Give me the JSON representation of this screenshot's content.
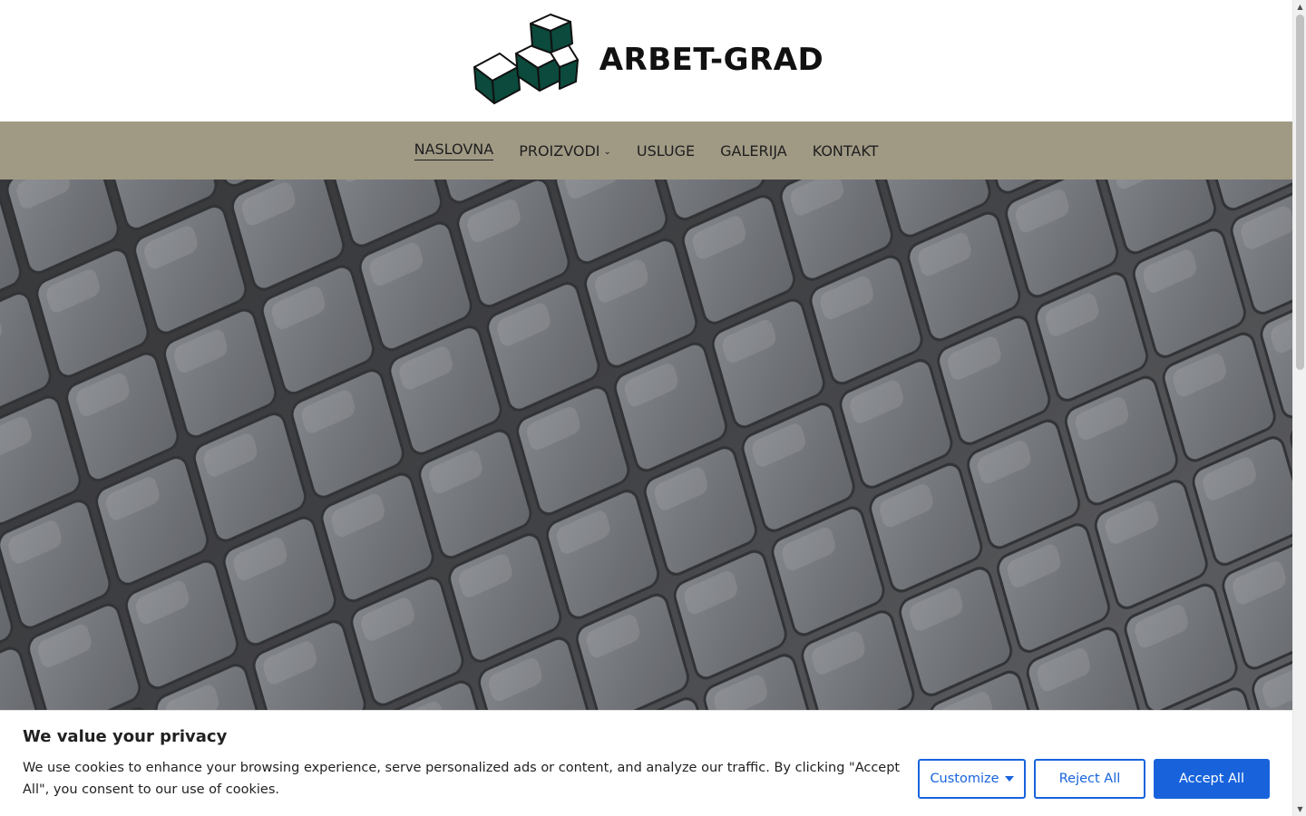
{
  "brand": {
    "name": "ARBET-GRAD",
    "logo_color": "#0b4a3c"
  },
  "nav": {
    "items": [
      {
        "label": "NASLOVNA",
        "active": true
      },
      {
        "label": "PROIZVODI",
        "dropdown": true
      },
      {
        "label": "USLUGE"
      },
      {
        "label": "GALERIJA"
      },
      {
        "label": "KONTAKT"
      }
    ],
    "background": "#a09a85"
  },
  "hero": {
    "image": "cobblestone-pavement-photo"
  },
  "cookie": {
    "title": "We value your privacy",
    "text": "We use cookies to enhance your browsing experience, serve personalized ads or content, and analyze our traffic. By clicking \"Accept All\", you consent to our use of cookies.",
    "customize_label": "Customize",
    "reject_label": "Reject All",
    "accept_label": "Accept All",
    "accent": "#1863dc"
  },
  "icons": {
    "dropdown": "chevron-down-icon",
    "customize": "caret-down-icon",
    "scroll_up": "arrow-up-icon",
    "scroll_down": "arrow-down-icon"
  }
}
